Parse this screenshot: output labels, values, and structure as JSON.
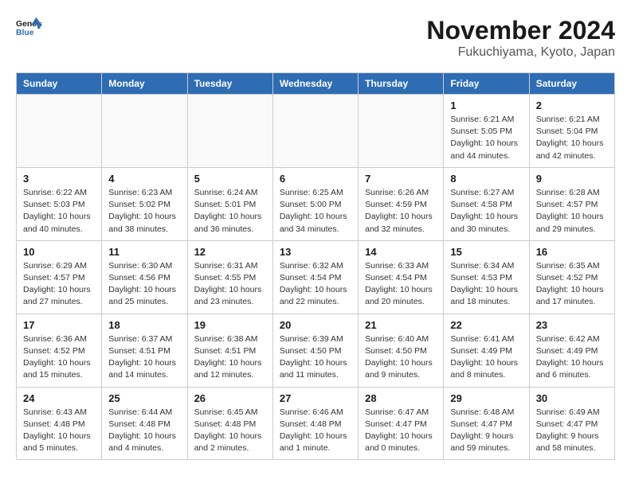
{
  "logo": {
    "line1": "General",
    "line2": "Blue"
  },
  "title": "November 2024",
  "location": "Fukuchiyama, Kyoto, Japan",
  "weekdays": [
    "Sunday",
    "Monday",
    "Tuesday",
    "Wednesday",
    "Thursday",
    "Friday",
    "Saturday"
  ],
  "weeks": [
    [
      {
        "day": "",
        "info": ""
      },
      {
        "day": "",
        "info": ""
      },
      {
        "day": "",
        "info": ""
      },
      {
        "day": "",
        "info": ""
      },
      {
        "day": "",
        "info": ""
      },
      {
        "day": "1",
        "info": "Sunrise: 6:21 AM\nSunset: 5:05 PM\nDaylight: 10 hours\nand 44 minutes."
      },
      {
        "day": "2",
        "info": "Sunrise: 6:21 AM\nSunset: 5:04 PM\nDaylight: 10 hours\nand 42 minutes."
      }
    ],
    [
      {
        "day": "3",
        "info": "Sunrise: 6:22 AM\nSunset: 5:03 PM\nDaylight: 10 hours\nand 40 minutes."
      },
      {
        "day": "4",
        "info": "Sunrise: 6:23 AM\nSunset: 5:02 PM\nDaylight: 10 hours\nand 38 minutes."
      },
      {
        "day": "5",
        "info": "Sunrise: 6:24 AM\nSunset: 5:01 PM\nDaylight: 10 hours\nand 36 minutes."
      },
      {
        "day": "6",
        "info": "Sunrise: 6:25 AM\nSunset: 5:00 PM\nDaylight: 10 hours\nand 34 minutes."
      },
      {
        "day": "7",
        "info": "Sunrise: 6:26 AM\nSunset: 4:59 PM\nDaylight: 10 hours\nand 32 minutes."
      },
      {
        "day": "8",
        "info": "Sunrise: 6:27 AM\nSunset: 4:58 PM\nDaylight: 10 hours\nand 30 minutes."
      },
      {
        "day": "9",
        "info": "Sunrise: 6:28 AM\nSunset: 4:57 PM\nDaylight: 10 hours\nand 29 minutes."
      }
    ],
    [
      {
        "day": "10",
        "info": "Sunrise: 6:29 AM\nSunset: 4:57 PM\nDaylight: 10 hours\nand 27 minutes."
      },
      {
        "day": "11",
        "info": "Sunrise: 6:30 AM\nSunset: 4:56 PM\nDaylight: 10 hours\nand 25 minutes."
      },
      {
        "day": "12",
        "info": "Sunrise: 6:31 AM\nSunset: 4:55 PM\nDaylight: 10 hours\nand 23 minutes."
      },
      {
        "day": "13",
        "info": "Sunrise: 6:32 AM\nSunset: 4:54 PM\nDaylight: 10 hours\nand 22 minutes."
      },
      {
        "day": "14",
        "info": "Sunrise: 6:33 AM\nSunset: 4:54 PM\nDaylight: 10 hours\nand 20 minutes."
      },
      {
        "day": "15",
        "info": "Sunrise: 6:34 AM\nSunset: 4:53 PM\nDaylight: 10 hours\nand 18 minutes."
      },
      {
        "day": "16",
        "info": "Sunrise: 6:35 AM\nSunset: 4:52 PM\nDaylight: 10 hours\nand 17 minutes."
      }
    ],
    [
      {
        "day": "17",
        "info": "Sunrise: 6:36 AM\nSunset: 4:52 PM\nDaylight: 10 hours\nand 15 minutes."
      },
      {
        "day": "18",
        "info": "Sunrise: 6:37 AM\nSunset: 4:51 PM\nDaylight: 10 hours\nand 14 minutes."
      },
      {
        "day": "19",
        "info": "Sunrise: 6:38 AM\nSunset: 4:51 PM\nDaylight: 10 hours\nand 12 minutes."
      },
      {
        "day": "20",
        "info": "Sunrise: 6:39 AM\nSunset: 4:50 PM\nDaylight: 10 hours\nand 11 minutes."
      },
      {
        "day": "21",
        "info": "Sunrise: 6:40 AM\nSunset: 4:50 PM\nDaylight: 10 hours\nand 9 minutes."
      },
      {
        "day": "22",
        "info": "Sunrise: 6:41 AM\nSunset: 4:49 PM\nDaylight: 10 hours\nand 8 minutes."
      },
      {
        "day": "23",
        "info": "Sunrise: 6:42 AM\nSunset: 4:49 PM\nDaylight: 10 hours\nand 6 minutes."
      }
    ],
    [
      {
        "day": "24",
        "info": "Sunrise: 6:43 AM\nSunset: 4:48 PM\nDaylight: 10 hours\nand 5 minutes."
      },
      {
        "day": "25",
        "info": "Sunrise: 6:44 AM\nSunset: 4:48 PM\nDaylight: 10 hours\nand 4 minutes."
      },
      {
        "day": "26",
        "info": "Sunrise: 6:45 AM\nSunset: 4:48 PM\nDaylight: 10 hours\nand 2 minutes."
      },
      {
        "day": "27",
        "info": "Sunrise: 6:46 AM\nSunset: 4:48 PM\nDaylight: 10 hours\nand 1 minute."
      },
      {
        "day": "28",
        "info": "Sunrise: 6:47 AM\nSunset: 4:47 PM\nDaylight: 10 hours\nand 0 minutes."
      },
      {
        "day": "29",
        "info": "Sunrise: 6:48 AM\nSunset: 4:47 PM\nDaylight: 9 hours\nand 59 minutes."
      },
      {
        "day": "30",
        "info": "Sunrise: 6:49 AM\nSunset: 4:47 PM\nDaylight: 9 hours\nand 58 minutes."
      }
    ]
  ]
}
